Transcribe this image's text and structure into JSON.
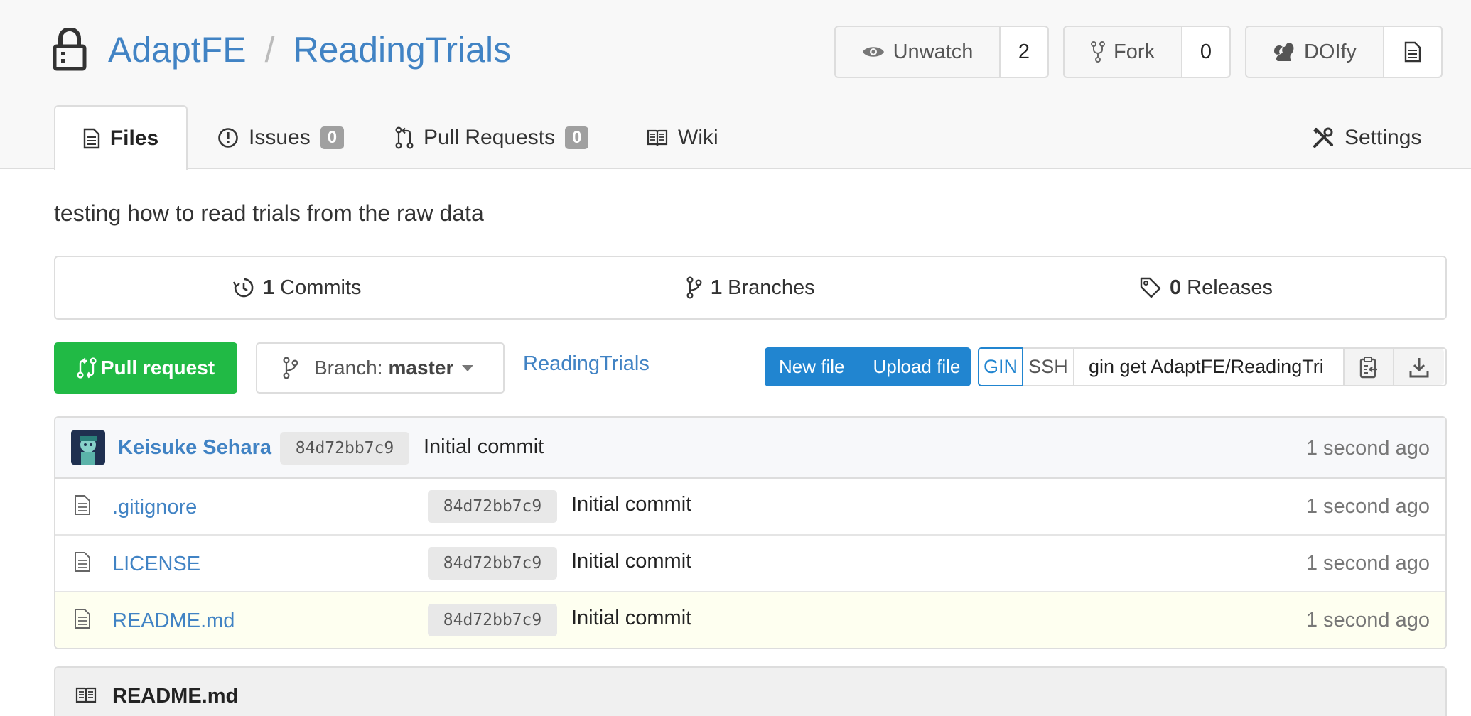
{
  "repo": {
    "owner": "AdaptFE",
    "separator": "/",
    "name": "ReadingTrials",
    "description": "testing how to read trials from the raw data"
  },
  "header_buttons": {
    "unwatch_label": "Unwatch",
    "watch_count": "2",
    "fork_label": "Fork",
    "fork_count": "0",
    "doi_label": "DOIfy"
  },
  "tabs": [
    {
      "label": "Files",
      "icon": "file-text-icon",
      "active": true
    },
    {
      "label": "Issues",
      "icon": "issue-icon",
      "badge": "0"
    },
    {
      "label": "Pull Requests",
      "icon": "git-pull-request-icon",
      "badge": "0"
    },
    {
      "label": "Wiki",
      "icon": "book-icon"
    },
    {
      "label": "Settings",
      "icon": "tools-icon"
    }
  ],
  "stats": {
    "commits_count": "1",
    "commits_label": "Commits",
    "branches_count": "1",
    "branches_label": "Branches",
    "releases_count": "0",
    "releases_label": "Releases"
  },
  "actions": {
    "pull_request_label": "Pull request",
    "branch_prefix": "Branch:",
    "branch_name": "master",
    "repo_link": "ReadingTrials",
    "new_file_label": "New file",
    "upload_file_label": "Upload file",
    "gin_label": "GIN",
    "ssh_label": "SSH",
    "clone_command": "gin get AdaptFE/ReadingTri"
  },
  "latest_commit": {
    "author": "Keisuke Sehara",
    "sha": "84d72bb7c9",
    "message": "Initial commit",
    "time": "1 second ago"
  },
  "files": [
    {
      "name": ".gitignore",
      "sha": "84d72bb7c9",
      "message": "Initial commit",
      "time": "1 second ago"
    },
    {
      "name": "LICENSE",
      "sha": "84d72bb7c9",
      "message": "Initial commit",
      "time": "1 second ago"
    },
    {
      "name": "README.md",
      "sha": "84d72bb7c9",
      "message": "Initial commit",
      "time": "1 second ago"
    }
  ],
  "readme": {
    "title": "README.md"
  },
  "colors": {
    "link": "#4183c4",
    "primary": "#2185d0",
    "success": "#21ba45",
    "highlight_row": "#fefff0"
  }
}
